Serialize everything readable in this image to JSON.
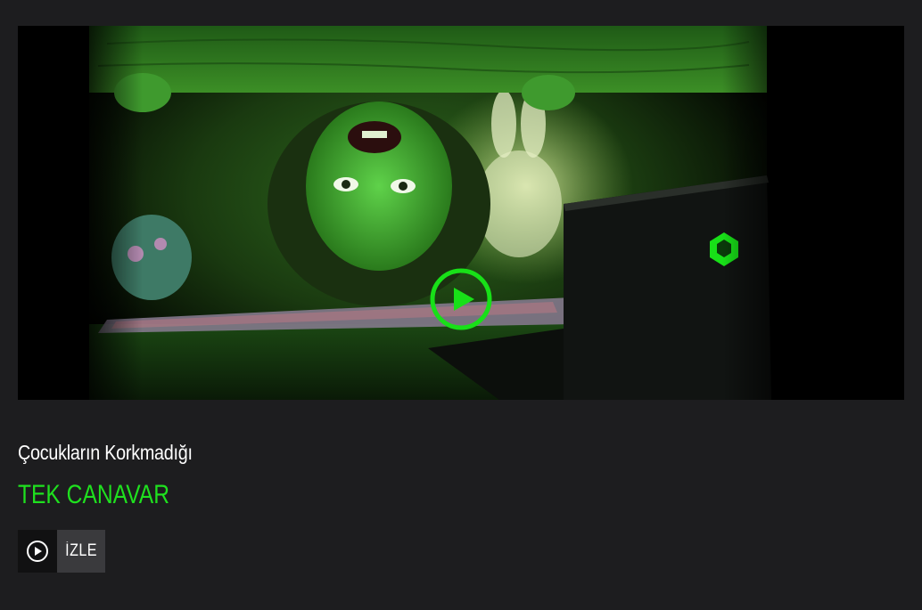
{
  "banner": {
    "accent_color": "#18e018"
  },
  "promo": {
    "subtitle": "Çocukların Korkmadığı",
    "headline": "TEK CANAVAR",
    "headline_color": "#1fe01f"
  },
  "watch_button": {
    "label": "İZLE",
    "icon": "play-circle-icon"
  }
}
